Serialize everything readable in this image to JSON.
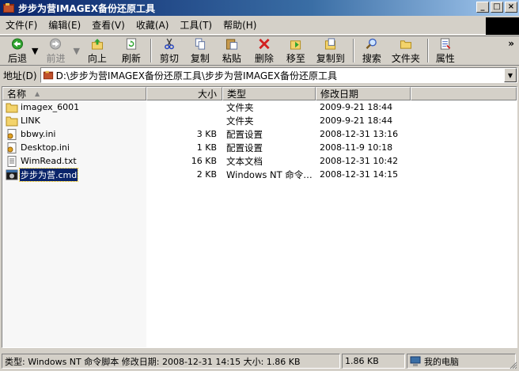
{
  "window": {
    "title": "步步为营IMAGEX备份还原工具",
    "buttons": {
      "minimize": "_",
      "maximize": "□",
      "close": "×"
    }
  },
  "menu": [
    "文件(F)",
    "编辑(E)",
    "查看(V)",
    "收藏(A)",
    "工具(T)",
    "帮助(H)"
  ],
  "toolbar": {
    "back": "后退",
    "forward": "前进",
    "up": "向上",
    "refresh": "刷新",
    "cut": "剪切",
    "copy": "复制",
    "paste": "粘贴",
    "delete": "删除",
    "move": "移至",
    "copyto": "复制到",
    "search": "搜索",
    "folders": "文件夹",
    "properties": "属性",
    "more": "»"
  },
  "address": {
    "label": "地址(D)",
    "value": "D:\\步步为营IMAGEX备份还原工具\\步步为营IMAGEX备份还原工具"
  },
  "columns": {
    "name": "名称",
    "size": "大小",
    "type": "类型",
    "modified": "修改日期"
  },
  "files": [
    {
      "name": "imagex_6001",
      "size": "",
      "type": "文件夹",
      "modified": "2009-9-21 18:44",
      "icon": "folder-icon"
    },
    {
      "name": "LINK",
      "size": "",
      "type": "文件夹",
      "modified": "2009-9-21 18:44",
      "icon": "folder-icon"
    },
    {
      "name": "bbwy.ini",
      "size": "3 KB",
      "type": "配置设置",
      "modified": "2008-12-31 13:16",
      "icon": "ini-file-icon"
    },
    {
      "name": "Desktop.ini",
      "size": "1 KB",
      "type": "配置设置",
      "modified": "2008-11-9 10:18",
      "icon": "ini-file-icon"
    },
    {
      "name": "WimRead.txt",
      "size": "16 KB",
      "type": "文本文档",
      "modified": "2008-12-31 10:42",
      "icon": "text-file-icon"
    },
    {
      "name": "步步为营.cmd",
      "size": "2 KB",
      "type": "Windows NT 命令…",
      "modified": "2008-12-31 14:15",
      "icon": "cmd-file-icon",
      "selected": true
    }
  ],
  "status": {
    "main": "类型: Windows NT 命令脚本 修改日期: 2008-12-31 14:15 大小: 1.86 KB",
    "size": "1.86 KB",
    "location": "我的电脑"
  }
}
